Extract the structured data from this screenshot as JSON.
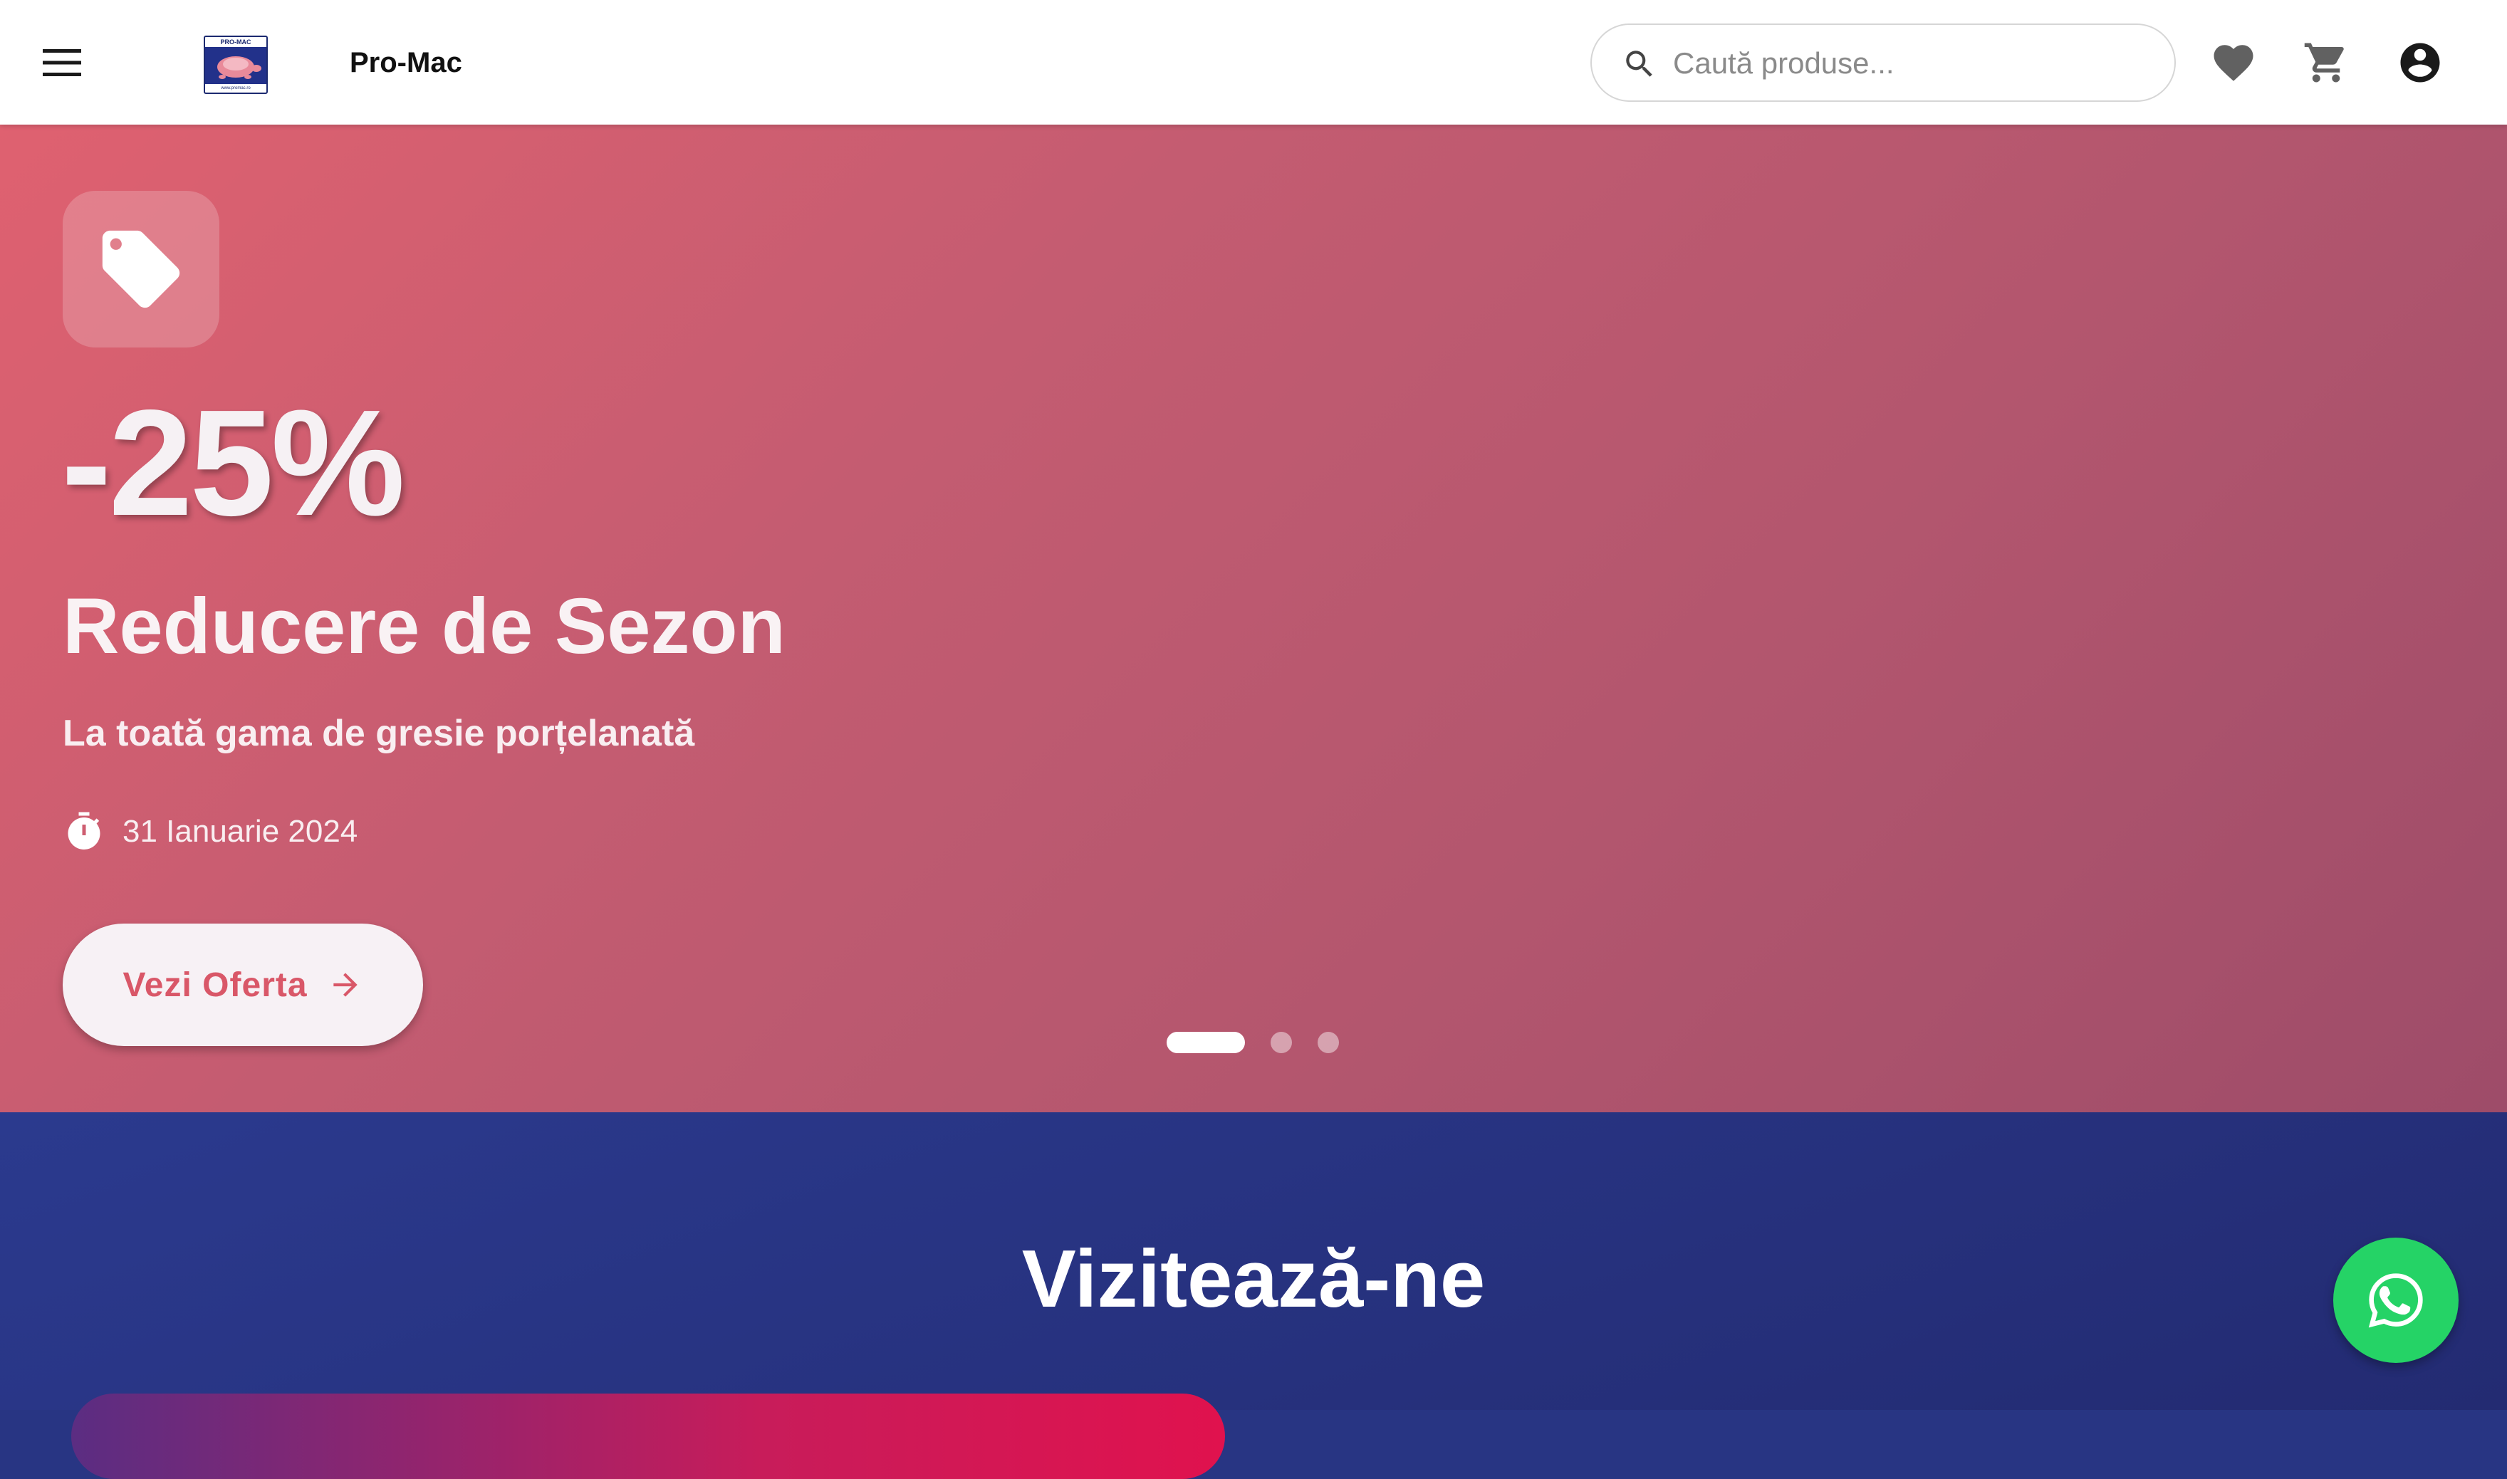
{
  "header": {
    "logo_text": "PRO-MAC",
    "brand_name": "Pro-Mac",
    "search_placeholder": "Caută produse..."
  },
  "hero": {
    "discount": "-25%",
    "title": "Reducere de Sezon",
    "subtitle": "La toată gama de gresie porțelanată",
    "date": "31 Ianuarie 2024",
    "cta_label": "Vezi Oferta",
    "slides_total": 3,
    "active_slide": 1
  },
  "visit": {
    "title": "Vizitează-ne"
  },
  "icons": {
    "menu": "menu-icon",
    "search": "search-icon",
    "wishlist": "heart-icon",
    "cart": "cart-icon",
    "account": "account-circle-icon",
    "tag": "tag-icon",
    "timer": "timer-icon",
    "arrow": "arrow-right-icon",
    "whatsapp": "whatsapp-icon"
  },
  "colors": {
    "hero_gradient_start": "#df6170",
    "hero_gradient_end": "#9e4c69",
    "cta_text": "#d95768",
    "visit_bg": "#283583",
    "whatsapp_green": "#25d366"
  }
}
